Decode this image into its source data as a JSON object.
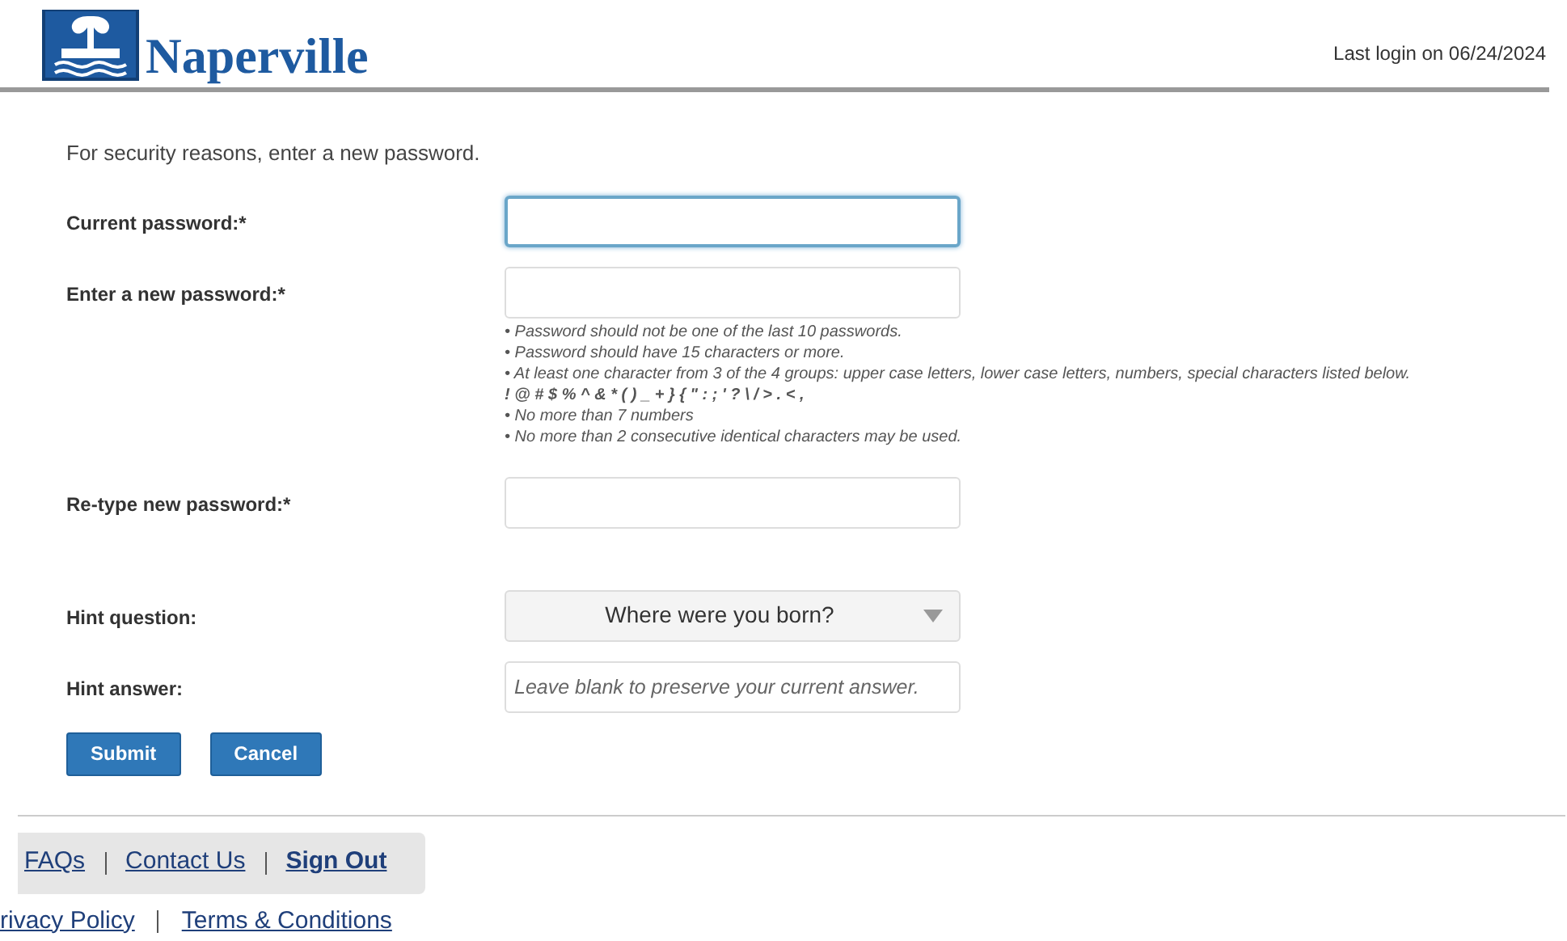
{
  "header": {
    "logo_text": "Naperville",
    "last_login": "Last login on 06/24/2024"
  },
  "intro": "For security reasons, enter a new password.",
  "fields": [
    {
      "kind": "password",
      "label": "Current password:*",
      "focused": true
    },
    {
      "kind": "password",
      "label": "Enter a new password:*",
      "focused": false,
      "rules": [
        "• Password should not be one of the last 10 passwords.",
        "• Password should have 15 characters or more.",
        "• At least one character from 3 of the 4 groups: upper case letters, lower case letters, numbers, special characters listed below.",
        "**! @ # $ % ^ & * ( ) _ + } { \" : ; ' ? \\ / > . < ,**",
        "• No more than 7 numbers",
        "• No more than 2 consecutive identical characters may be used."
      ]
    },
    {
      "kind": "password",
      "label": "Re-type new password:*",
      "focused": false
    },
    {
      "kind": "select",
      "label": "Hint question:",
      "value": "Where were you born?"
    },
    {
      "kind": "text",
      "label": "Hint answer:",
      "placeholder": "Leave blank to preserve your current answer."
    }
  ],
  "buttons": [
    "Submit",
    "Cancel"
  ],
  "footer": {
    "links": [
      {
        "label": "FAQs",
        "bold": false
      },
      {
        "label": "Contact Us",
        "bold": false
      },
      {
        "label": "Sign Out",
        "bold": true
      }
    ],
    "legal": [
      "rivacy Policy",
      "Terms & Conditions"
    ]
  }
}
